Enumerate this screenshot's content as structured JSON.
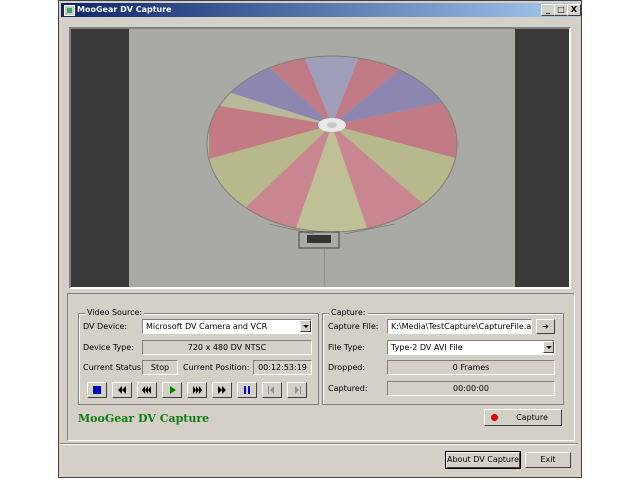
{
  "window": {
    "title": "MooGear DV Capture",
    "controls": {
      "minimize": "_",
      "maximize": "□",
      "close": "X"
    }
  },
  "video_source": {
    "group_label": "Video Source:",
    "device_label": "DV Device:",
    "device_value": "Microsoft DV Camera and VCR",
    "device_type_label": "Device Type:",
    "device_type_value": "720 x 480 DV NTSC",
    "status_label": "Current Status:",
    "status_value": "Stop",
    "position_label": "Current Position:",
    "position_value": "00:12:53:19",
    "transport_icons": [
      "stop-icon",
      "rewind-icon",
      "fast-rewind-icon",
      "play-icon",
      "fast-forward-icon",
      "forward-icon",
      "pause-icon",
      "step-back-icon",
      "step-forward-icon"
    ]
  },
  "capture": {
    "group_label": "Capture:",
    "file_label": "Capture File:",
    "file_value": "K:\\Media\\TestCapture\\CaptureFile.avi",
    "file_type_label": "File Type:",
    "file_type_value": "Type-2 DV AVI File",
    "dropped_label": "Dropped:",
    "dropped_value": "0 Frames",
    "captured_label": "Captured:",
    "captured_value": "00:00:00",
    "capture_button": "Capture"
  },
  "brand": "MooGear DV Capture",
  "footer": {
    "about_button": "About DV Capture",
    "exit_button": "Exit"
  },
  "colors": {
    "title_gradient_start": "#0a246a",
    "title_gradient_end": "#a6caf0",
    "brand_green": "#107c10",
    "record_red": "#e00000",
    "transport_blue": "#0000c0",
    "play_green": "#008000"
  }
}
